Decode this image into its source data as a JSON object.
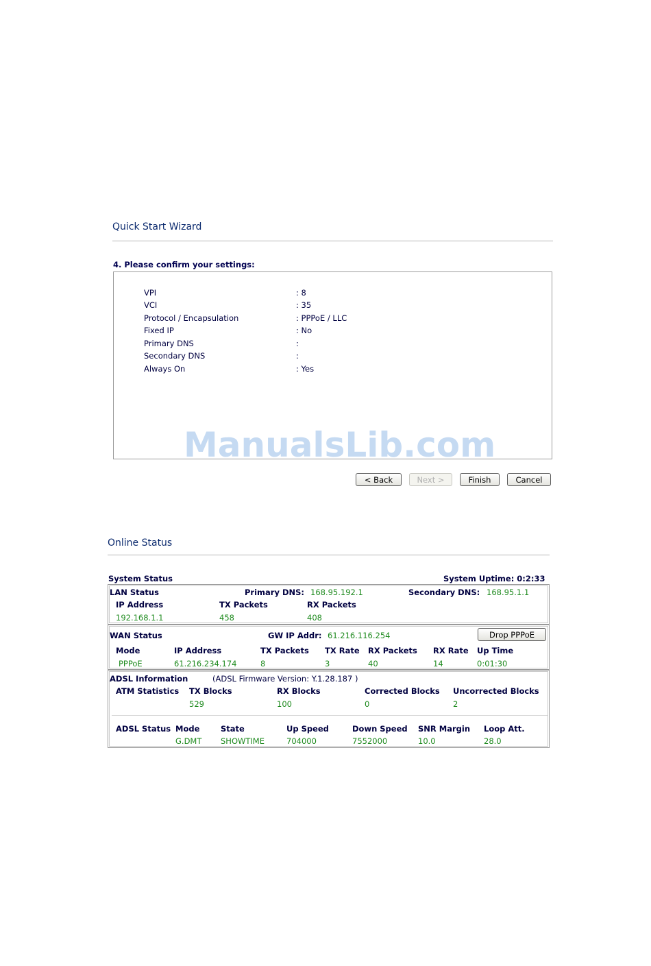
{
  "wizard": {
    "title": "Quick Start Wizard",
    "step_heading": "4. Please confirm your settings:",
    "settings": [
      {
        "label": "VPI",
        "value": ": 8"
      },
      {
        "label": "VCI",
        "value": ": 35"
      },
      {
        "label": "Protocol / Encapsulation",
        "value": ": PPPoE / LLC"
      },
      {
        "label": "Fixed IP",
        "value": ": No"
      },
      {
        "label": "Primary DNS",
        "value": ":"
      },
      {
        "label": "Secondary DNS",
        "value": ":"
      },
      {
        "label": "Always On",
        "value": ": Yes"
      }
    ],
    "watermark": "ManualsLib.com",
    "buttons": {
      "back": "< Back",
      "next": "Next >",
      "finish": "Finish",
      "cancel": "Cancel"
    }
  },
  "online": {
    "title": "Online Status",
    "system_status_label": "System Status",
    "uptime_label": "System Uptime: 0:2:33",
    "lan": {
      "title": "LAN Status",
      "primary_dns_label": "Primary DNS:",
      "primary_dns": "168.95.192.1",
      "secondary_dns_label": "Secondary DNS:",
      "secondary_dns": "168.95.1.1",
      "headers": [
        "IP Address",
        "TX Packets",
        "RX Packets"
      ],
      "values": [
        "192.168.1.1",
        "458",
        "408"
      ]
    },
    "wan": {
      "title": "WAN Status",
      "gw_label": "GW IP Addr:",
      "gw_value": "61.216.116.254",
      "drop_button": "Drop PPPoE",
      "headers": [
        "Mode",
        "IP Address",
        "TX Packets",
        "TX Rate",
        "RX Packets",
        "RX Rate",
        "Up Time"
      ],
      "values": [
        "PPPoE",
        "61.216.234.174",
        "8",
        "3",
        "40",
        "14",
        "0:01:30"
      ]
    },
    "adsl": {
      "title": "ADSL Information",
      "firmware": "(ADSL Firmware Version:   Y.1.28.187 )",
      "atm_label": "ATM Statistics",
      "atm_headers": [
        "TX Blocks",
        "RX Blocks",
        "Corrected Blocks",
        "Uncorrected Blocks"
      ],
      "atm_values": [
        "529",
        "100",
        "0",
        "2"
      ],
      "status_label": "ADSL Status",
      "status_headers": [
        "Mode",
        "State",
        "Up Speed",
        "Down Speed",
        "SNR Margin",
        "Loop Att."
      ],
      "status_values": [
        "G.DMT",
        "SHOWTIME",
        "704000",
        "7552000",
        "10.0",
        "28.0"
      ]
    }
  }
}
